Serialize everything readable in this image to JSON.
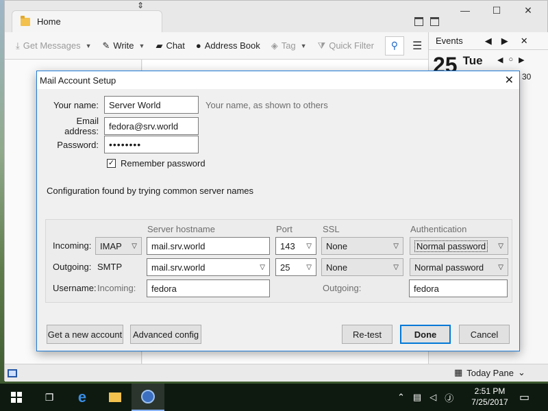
{
  "tab": {
    "label": "Home"
  },
  "toolbar": {
    "get_messages": "Get Messages",
    "write": "Write",
    "chat": "Chat",
    "address_book": "Address Book",
    "tag": "Tag",
    "quick_filter": "Quick Filter"
  },
  "events": {
    "title": "Events",
    "day_number": "25",
    "day_name": "Tue",
    "mini_day": "30"
  },
  "statusbar": {
    "today_pane": "Today Pane"
  },
  "dialog": {
    "title": "Mail Account Setup",
    "name_label": "Your name:",
    "name_value": "Server World",
    "name_hint": "Your name, as shown to others",
    "email_label": "Email address:",
    "email_value": "fedora@srv.world",
    "password_label": "Password:",
    "password_value": "••••••••",
    "remember_label": "Remember password",
    "remember_checked": true,
    "config_message": "Configuration found by trying common server names",
    "columns": {
      "hostname": "Server hostname",
      "port": "Port",
      "ssl": "SSL",
      "auth": "Authentication"
    },
    "incoming": {
      "label": "Incoming:",
      "protocol": "IMAP",
      "hostname": "mail.srv.world",
      "port": "143",
      "ssl": "None",
      "auth": "Normal password"
    },
    "outgoing": {
      "label": "Outgoing:",
      "protocol": "SMTP",
      "hostname": "mail.srv.world",
      "port": "25",
      "ssl": "None",
      "auth": "Normal password"
    },
    "username": {
      "label": "Username:",
      "incoming_label": "Incoming:",
      "incoming_value": "fedora",
      "outgoing_label": "Outgoing:",
      "outgoing_value": "fedora"
    },
    "buttons": {
      "new_account": "Get a new account",
      "advanced": "Advanced config",
      "retest": "Re-test",
      "done": "Done",
      "cancel": "Cancel"
    }
  },
  "taskbar": {
    "time": "2:51 PM",
    "date": "7/25/2017"
  },
  "colors": {
    "accent": "#0078d7",
    "taskbar": "#0e1a10"
  }
}
